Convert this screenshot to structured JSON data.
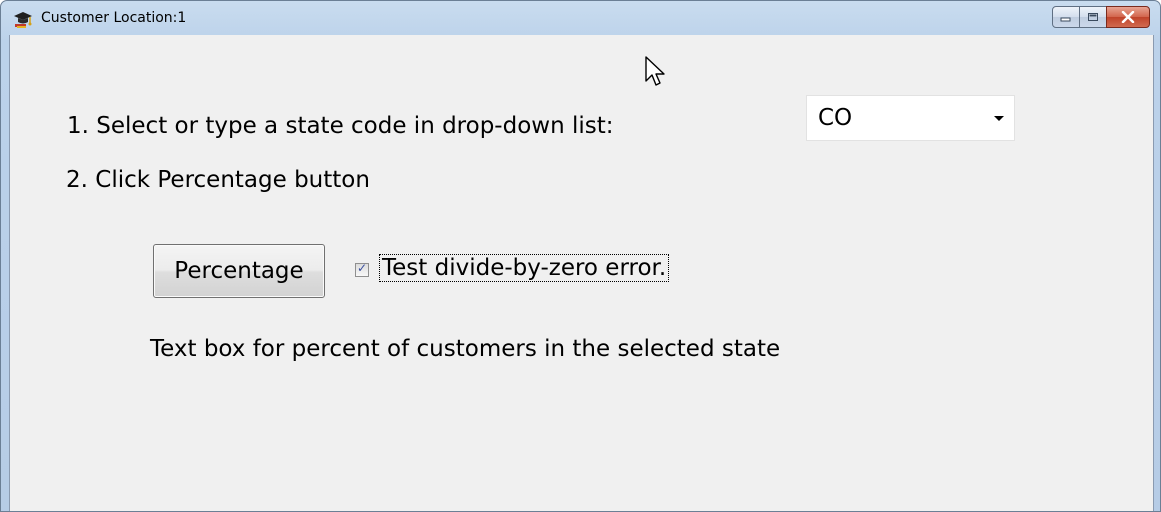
{
  "window": {
    "title": "Customer Location:1",
    "icon": "graduation-cap-app-icon",
    "controls": [
      "minimize",
      "maximize",
      "close"
    ]
  },
  "instructions": {
    "step1": "1. Select or type a state code in drop-down list:",
    "step2": "2. Click Percentage button"
  },
  "state_combo": {
    "value": "CO"
  },
  "percentage_button": {
    "label": "Percentage"
  },
  "divide_checkbox": {
    "label": "Test divide-by-zero error.",
    "checked": true
  },
  "result": {
    "label": "Text box for percent of customers in the selected state"
  },
  "colors": {
    "client_background": "#f0f0f0",
    "frame": "#bcd2ea",
    "close_button": "#c9482f"
  }
}
